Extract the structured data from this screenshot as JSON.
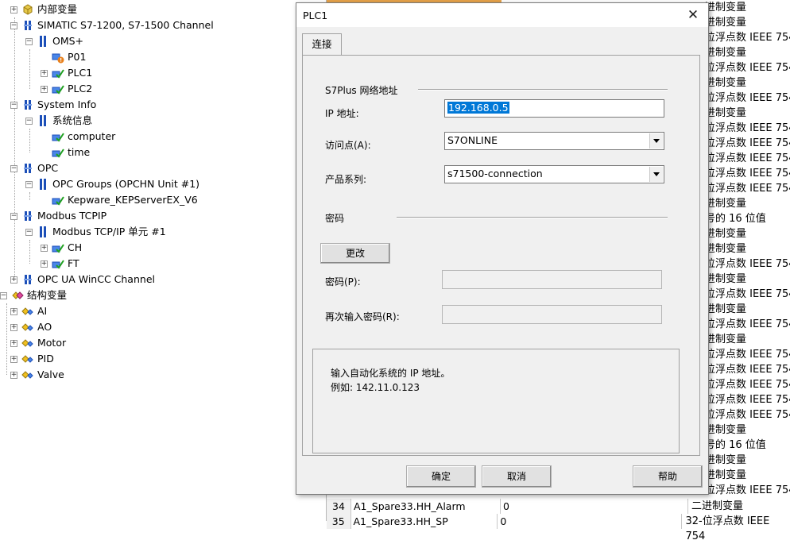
{
  "tree": {
    "items": [
      {
        "label": "内部变量",
        "icon": "internal-variables-icon"
      },
      {
        "label": "SIMATIC S7-1200, S7-1500 Channel",
        "icon": "channel-icon"
      },
      {
        "label": "OMS+",
        "icon": "unit-icon"
      },
      {
        "label": "P01",
        "icon": "connection-error-icon"
      },
      {
        "label": "PLC1",
        "icon": "connection-icon"
      },
      {
        "label": "PLC2",
        "icon": "connection-icon"
      },
      {
        "label": "System Info",
        "icon": "channel-icon"
      },
      {
        "label": "系统信息",
        "icon": "unit-icon"
      },
      {
        "label": "computer",
        "icon": "connection-icon"
      },
      {
        "label": "time",
        "icon": "connection-icon"
      },
      {
        "label": "OPC",
        "icon": "channel-icon"
      },
      {
        "label": "OPC Groups (OPCHN Unit #1)",
        "icon": "unit-icon"
      },
      {
        "label": "Kepware_KEPServerEX_V6",
        "icon": "connection-icon"
      },
      {
        "label": "Modbus TCPIP",
        "icon": "channel-icon"
      },
      {
        "label": "Modbus TCP/IP 单元 #1",
        "icon": "unit-icon"
      },
      {
        "label": "CH",
        "icon": "connection-icon"
      },
      {
        "label": "FT",
        "icon": "connection-icon"
      },
      {
        "label": "OPC UA WinCC Channel",
        "icon": "channel-icon"
      },
      {
        "label": "结构变量",
        "icon": "struct-variables-icon"
      },
      {
        "label": "AI",
        "icon": "struct-type-icon"
      },
      {
        "label": "AO",
        "icon": "struct-type-icon"
      },
      {
        "label": "Motor",
        "icon": "struct-type-icon"
      },
      {
        "label": "PID",
        "icon": "struct-type-icon"
      },
      {
        "label": "Valve",
        "icon": "struct-type-icon"
      }
    ]
  },
  "grid": {
    "type_cells": [
      "进制变量",
      "进制变量",
      "位浮点数 IEEE 754",
      "进制变量",
      "位浮点数 IEEE 754",
      "进制变量",
      "位浮点数 IEEE 754",
      "进制变量",
      "位浮点数 IEEE 754",
      "位浮点数 IEEE 754",
      "位浮点数 IEEE 754",
      "位浮点数 IEEE 754",
      "位浮点数 IEEE 754",
      "进制变量",
      "号的 16 位值",
      "进制变量",
      "进制变量",
      "位浮点数 IEEE 754",
      "进制变量",
      "位浮点数 IEEE 754",
      "进制变量",
      "位浮点数 IEEE 754",
      "进制变量",
      "位浮点数 IEEE 754",
      "位浮点数 IEEE 754",
      "位浮点数 IEEE 754",
      "位浮点数 IEEE 754",
      "位浮点数 IEEE 754",
      "进制变量",
      "号的 16 位值",
      "进制变量",
      "进制变量",
      "位浮点数 IEEE 754"
    ],
    "rows": [
      {
        "index": "34",
        "name": "A1_Spare33.HH_Alarm",
        "value": "0",
        "type": "二进制变量"
      },
      {
        "index": "35",
        "name": "A1_Spare33.HH_SP",
        "value": "0",
        "type": "32-位浮点数 IEEE 754"
      }
    ]
  },
  "dialog": {
    "title": "PLC1",
    "close_glyph": "✕",
    "tab_label": "连接",
    "section_network": "S7Plus 网络地址",
    "ip_label": "IP 地址:",
    "ip_value": "192.168.0.5",
    "access_point_label": "访问点(A):",
    "access_point_value": "S7ONLINE",
    "product_family_label": "产品系列:",
    "product_family_value": "s71500-connection",
    "section_password": "密码",
    "change_button": "更改",
    "password_label": "密码(P):",
    "password_confirm_label": "再次输入密码(R):",
    "info_line1": "输入自动化系统的 IP 地址。",
    "info_line2": "例如: 142.11.0.123",
    "ok_button": "确定",
    "cancel_button": "取消",
    "help_button": "帮助"
  }
}
